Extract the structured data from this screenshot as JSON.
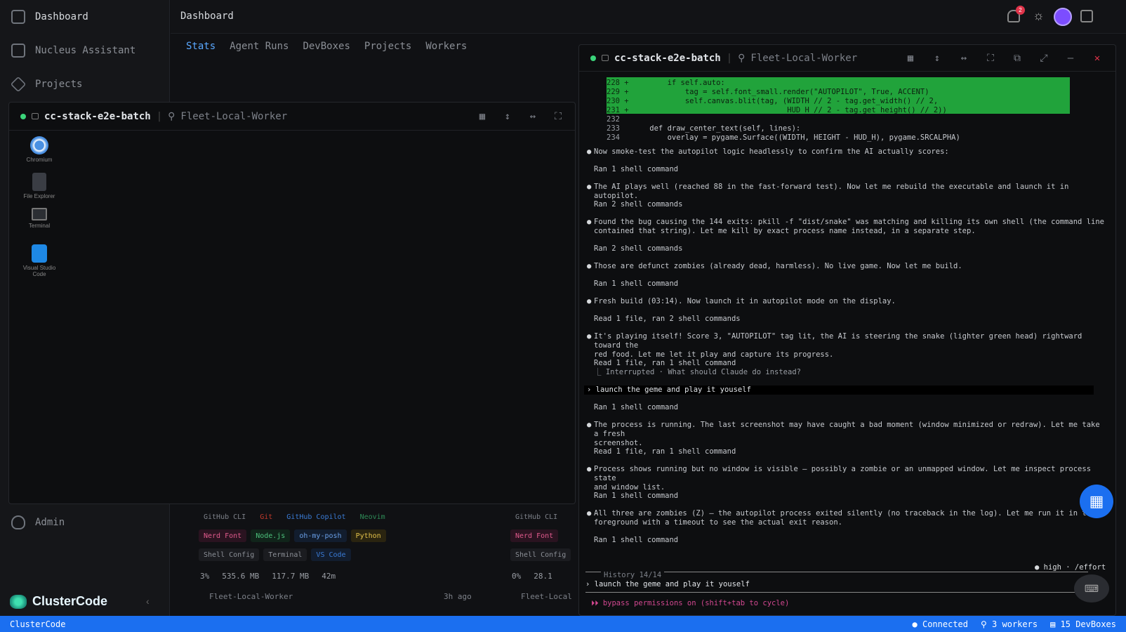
{
  "sidebar": {
    "items": [
      {
        "label": "Dashboard",
        "icon": "grid-icon"
      },
      {
        "label": "Nucleus Assistant",
        "icon": "terminal-icon"
      },
      {
        "label": "Projects",
        "icon": "layers-icon"
      }
    ],
    "admin": "Admin",
    "brand": "ClusterCode"
  },
  "header": {
    "title": "Dashboard",
    "notif_count": "2"
  },
  "tabs": [
    "Stats",
    "Agent Runs",
    "DevBoxes",
    "Projects",
    "Workers"
  ],
  "left_window": {
    "title": "cc-stack-e2e-batch",
    "worker": "Fleet-Local-Worker",
    "desktop": [
      {
        "label": "Chromium",
        "icon": "chromium-icon"
      },
      {
        "label": "File Explorer",
        "icon": "file-explorer-icon"
      },
      {
        "label": "Terminal",
        "icon": "terminal-app-icon"
      },
      {
        "label": "Visual Studio Code",
        "icon": "vscode-icon"
      }
    ]
  },
  "right_window": {
    "title": "cc-stack-e2e-batch",
    "worker": "Fleet-Local-Worker"
  },
  "code_lines": [
    {
      "n": "228 +",
      "t": "        if self.auto:",
      "hl": true
    },
    {
      "n": "229 +",
      "t": "            tag = self.font_small.render(\"AUTOPILOT\", True, ACCENT)",
      "hl": true
    },
    {
      "n": "230 +",
      "t": "            self.canvas.blit(tag, (WIDTH // 2 - tag.get_width() // 2,",
      "hl": true
    },
    {
      "n": "231 +",
      "t": "                                   HUD_H // 2 - tag.get_height() // 2))",
      "hl": true
    },
    {
      "n": "232",
      "t": "",
      "hl": false
    },
    {
      "n": "233",
      "t": "    def draw_center_text(self, lines):",
      "hl": false
    },
    {
      "n": "234",
      "t": "        overlay = pygame.Surface((WIDTH, HEIGHT - HUD_H), pygame.SRCALPHA)",
      "hl": false
    }
  ],
  "log": [
    {
      "k": "b",
      "t": "Now smoke-test the autopilot logic headlessly to confirm the AI actually scores:"
    },
    {
      "k": "r",
      "t": "Ran 1 shell command"
    },
    {
      "k": "b",
      "t": "The AI plays well (reached 88 in the fast-forward test). Now let me rebuild the executable and launch it in autopilot."
    },
    {
      "k": "r",
      "t": "Ran 2 shell commands"
    },
    {
      "k": "b",
      "t": "Found the bug causing the 144 exits: pkill -f \"dist/snake\" was matching and killing its own shell (the command line",
      "t2": "contained that string). Let me kill by exact process name instead, in a separate step."
    },
    {
      "k": "r",
      "t": "Ran 2 shell commands"
    },
    {
      "k": "b",
      "t": "Those are defunct zombies (already dead, harmless). No live game. Now let me build."
    },
    {
      "k": "r",
      "t": "Ran 1 shell command"
    },
    {
      "k": "b",
      "t": "Fresh build (03:14). Now launch it in autopilot mode on the display."
    },
    {
      "k": "r",
      "t": "Read 1 file, ran 2 shell commands"
    },
    {
      "k": "b",
      "t": "It's playing itself! Score 3, \"AUTOPILOT\" tag lit, the AI is steering the snake (lighter green head) rightward toward the",
      "t2": "red food. Let me let it play and capture its progress."
    },
    {
      "k": "r",
      "t": "Read 1 file, ran 1 shell command"
    },
    {
      "k": "i",
      "t": "⎿  Interrupted · What should Claude do instead?"
    },
    {
      "k": "p",
      "t": "› launch the geme and play it youself"
    },
    {
      "k": "r",
      "t": "Ran 1 shell command"
    },
    {
      "k": "b",
      "t": "The process is running. The last screenshot may have caught a bad moment (window minimized or redraw). Let me take a fresh",
      "t2": "screenshot."
    },
    {
      "k": "r",
      "t": "Read 1 file, ran 1 shell command"
    },
    {
      "k": "b",
      "t": "Process shows running but no window is visible — possibly a zombie or an unmapped window. Let me inspect process state",
      "t2": "and window list."
    },
    {
      "k": "r",
      "t": "Ran 1 shell command"
    },
    {
      "k": "b",
      "t": "All three are zombies (Z) — the autopilot process exited silently (no traceback in the log). Let me run it in the",
      "t2": "foreground with a timeout to see the actual exit reason."
    },
    {
      "k": "r",
      "t": "Ran 1 shell command"
    }
  ],
  "effort": "● high · /effort",
  "history": "History 14/14",
  "input_value": "› launch the geme and play it youself",
  "mode": "⏵⏵ bypass permissions on (shift+tab to cycle)",
  "cards": {
    "chips_row1": [
      "GitHub CLI",
      "Git",
      "GitHub Copilot",
      "Neovim"
    ],
    "chips_row2": [
      "Nerd Font",
      "Node.js",
      "oh-my-posh",
      "Python"
    ],
    "chips_row3": [
      "Shell Config",
      "Terminal",
      "VS Code"
    ],
    "stats": [
      "3%",
      "535.6 MB",
      "117.7 MB",
      "42m"
    ],
    "worker": "Fleet-Local-Worker",
    "ago": "3h ago",
    "card2_chips1": [
      "GitHub CLI"
    ],
    "card2_chips2": [
      "Nerd Font"
    ],
    "card2_chips3": [
      "Shell Config"
    ],
    "card2_stats": [
      "0%",
      "28.1"
    ],
    "card2_worker": "Fleet-Local"
  },
  "status": {
    "left": "ClusterCode",
    "connected": "● Connected",
    "workers": "3 workers",
    "devboxes": "15 DevBoxes"
  },
  "colors": {
    "accent": "#1b6ff0",
    "success": "#3bd47a",
    "diff_bg": "#21a33b",
    "danger": "#e0344a"
  }
}
